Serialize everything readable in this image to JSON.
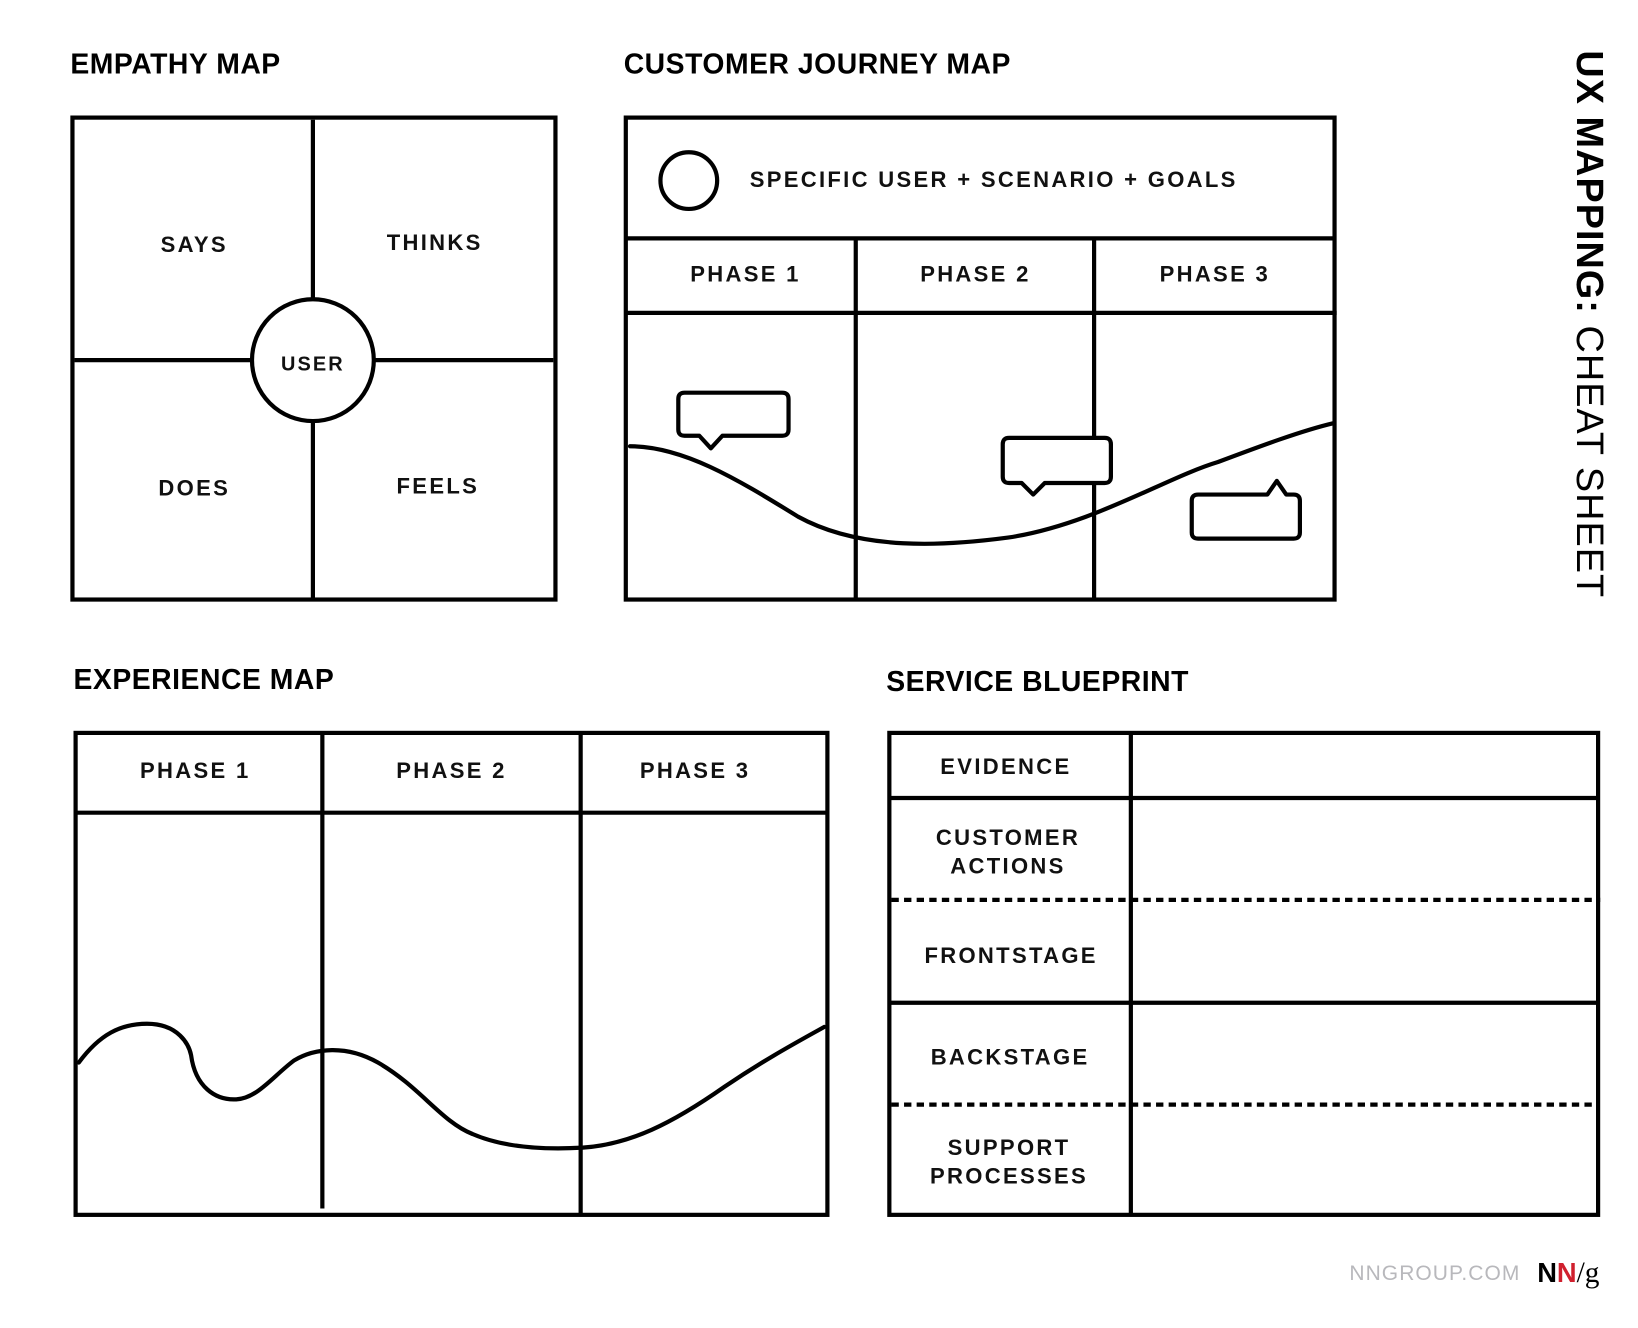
{
  "side_title": {
    "bold": "UX MAPPING:",
    "light": " CHEAT SHEET"
  },
  "empathy_map": {
    "title": "EMPATHY MAP",
    "center": "USER",
    "quadrants": [
      "SAYS",
      "THINKS",
      "DOES",
      "FEELS"
    ]
  },
  "journey_map": {
    "title": "CUSTOMER JOURNEY MAP",
    "header": "SPECIFIC USER + SCENARIO + GOALS",
    "phases": [
      "PHASE 1",
      "PHASE 2",
      "PHASE 3"
    ],
    "icons": [
      "persona-circle-icon",
      "speech-bubble-icon"
    ]
  },
  "experience_map": {
    "title": "EXPERIENCE MAP",
    "phases": [
      "PHASE 1",
      "PHASE 2",
      "PHASE 3"
    ]
  },
  "service_blueprint": {
    "title": "SERVICE BLUEPRINT",
    "rows": [
      {
        "lines": [
          "EVIDENCE"
        ]
      },
      {
        "lines": [
          "CUSTOMER",
          "ACTIONS"
        ]
      },
      {
        "lines": [
          "FRONTSTAGE"
        ]
      },
      {
        "lines": [
          "BACKSTAGE"
        ]
      },
      {
        "lines": [
          "SUPPORT",
          "PROCESSES"
        ]
      }
    ]
  },
  "footer": {
    "site": "NNGROUP.COM",
    "logo": {
      "n1": "N",
      "n2": "N",
      "slash_g": "/g"
    },
    "colors": {
      "logo_black": "#000000",
      "logo_red": "#d0202e",
      "site_gray": "#b8b8bc"
    }
  }
}
